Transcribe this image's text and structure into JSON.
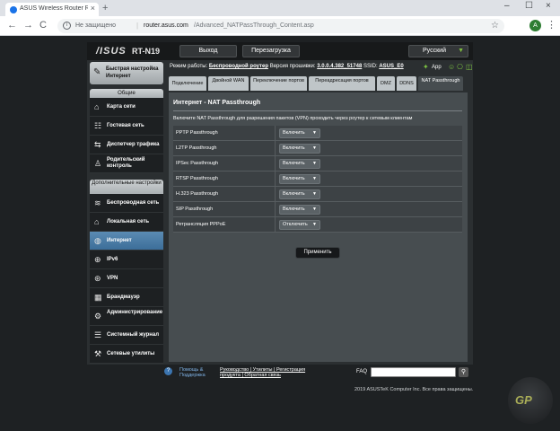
{
  "browser": {
    "tab_title": "ASUS Wireless Router RT-N19 - /",
    "tab_close": "×",
    "new_tab": "+",
    "win_min": "–",
    "win_max": "☐",
    "win_close": "×",
    "back": "←",
    "forward": "→",
    "reload": "C",
    "info_glyph": "i",
    "secure_text": "Не защищено",
    "url_host": "router.asus.com",
    "url_path": "/Advanced_NATPassThrough_Content.asp",
    "star": "☆",
    "profile_letter": "A",
    "menu": "⋮"
  },
  "router": {
    "logo": "/ISUS",
    "model": "RT-N19",
    "logout": "Выход",
    "reboot": "Перезагрузка",
    "language": "Русский",
    "status": {
      "mode_label": "Режим работы:",
      "mode_value": "Беспроводной роутер",
      "fw_label": "Версия прошивки:",
      "fw_value": "3.0.0.4.382_51748",
      "ssid_label": "SSID:",
      "ssid_value": "ASUS_E0",
      "app_label": "App"
    },
    "sidebar": {
      "quick": "Быстрая настройка Интернет",
      "general_header": "Общие",
      "general": [
        {
          "label": "Карта сети",
          "icon": "⌂"
        },
        {
          "label": "Гостевая сеть",
          "icon": "☷"
        },
        {
          "label": "Диспетчер трафика",
          "icon": "⇆"
        },
        {
          "label": "Родительский контроль",
          "icon": "♙"
        }
      ],
      "advanced_header": "Дополнительные настройки",
      "advanced": [
        {
          "label": "Беспроводная сеть",
          "icon": "≋"
        },
        {
          "label": "Локальная сеть",
          "icon": "⌂"
        },
        {
          "label": "Интернет",
          "icon": "◍"
        },
        {
          "label": "IPv6",
          "icon": "⊕"
        },
        {
          "label": "VPN",
          "icon": "⊛"
        },
        {
          "label": "Брандмауэр",
          "icon": "▦"
        },
        {
          "label": "Администрирование",
          "icon": "⚙"
        },
        {
          "label": "Системный журнал",
          "icon": "☰"
        },
        {
          "label": "Сетевые утилиты",
          "icon": "⚒"
        }
      ]
    },
    "tabs": [
      "Подключение",
      "Двойной WAN",
      "Переключение портов",
      "Переадресация портов",
      "DMZ",
      "DDNS",
      "NAT Passthrough"
    ],
    "content": {
      "title": "Интернет - NAT Passthrough",
      "description": "Включите NAT Passthrough для разрешения пакетов (VPN) проходить через роутер к сетевым клиентам",
      "rows": [
        {
          "name": "PPTP Passthrough",
          "value": "Включить"
        },
        {
          "name": "L2TP Passthrough",
          "value": "Включить"
        },
        {
          "name": "IPSec Passthrough",
          "value": "Включить"
        },
        {
          "name": "RTSP Passthrough",
          "value": "Включить"
        },
        {
          "name": "H.323 Passthrough",
          "value": "Включить"
        },
        {
          "name": "SIP Passthrough",
          "value": "Включить"
        },
        {
          "name": "Ретрансляция PPPoE",
          "value": "Отключить"
        }
      ],
      "select_arrow": "▼",
      "apply": "Применить"
    },
    "footer": {
      "help_glyph": "?",
      "help": "Помощь & Поддержка",
      "links_line1": "Руководство | Утилиты | Регистрация",
      "links_line2": "продукта | Обратная связь",
      "faq": "FAQ",
      "search_glyph": "⚲"
    },
    "copyright": "2019 ASUSTeK Computer Inc. Все права защищены."
  },
  "watermark": "GP",
  "colors": {
    "accent": "#3c6e99",
    "app_green": "#7cc142"
  }
}
